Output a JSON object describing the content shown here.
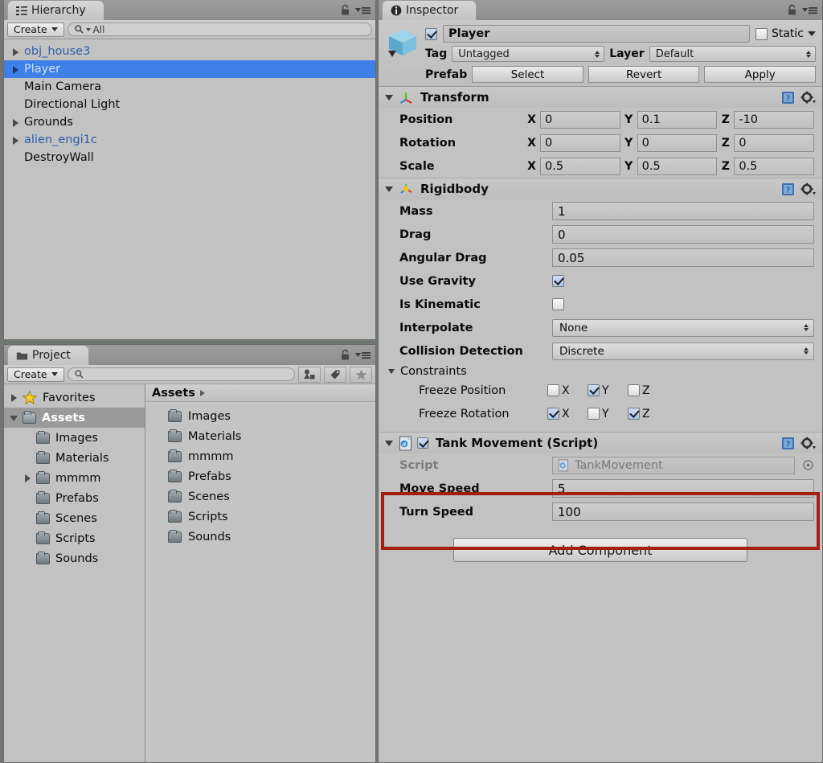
{
  "hierarchy": {
    "tab_title": "Hierarchy",
    "tab_icon": "hierarchy-icon",
    "create_label": "Create",
    "search_value": "All",
    "items": [
      {
        "label": "obj_house3",
        "expandable": true,
        "selected": false,
        "prefab": true,
        "depth": 0
      },
      {
        "label": "Player",
        "expandable": true,
        "selected": true,
        "prefab": true,
        "depth": 0
      },
      {
        "label": "Main Camera",
        "expandable": false,
        "selected": false,
        "prefab": false,
        "depth": 0
      },
      {
        "label": "Directional Light",
        "expandable": false,
        "selected": false,
        "prefab": false,
        "depth": 0
      },
      {
        "label": "Grounds",
        "expandable": true,
        "selected": false,
        "prefab": false,
        "depth": 0
      },
      {
        "label": "alien_engi1c",
        "expandable": true,
        "selected": false,
        "prefab": true,
        "depth": 0
      },
      {
        "label": "DestroyWall",
        "expandable": false,
        "selected": false,
        "prefab": false,
        "depth": 0
      }
    ]
  },
  "project": {
    "tab_title": "Project",
    "create_label": "Create",
    "search_value": "",
    "breadcrumb": "Assets",
    "favorites_label": "Favorites",
    "tree": [
      {
        "label": "Favorites",
        "type": "favorites",
        "expandable": true,
        "selected": false,
        "depth": 0
      },
      {
        "label": "Assets",
        "type": "folder",
        "expandable": true,
        "expanded": true,
        "selected": true,
        "depth": 0
      },
      {
        "label": "Images",
        "type": "folder",
        "expandable": false,
        "selected": false,
        "depth": 1
      },
      {
        "label": "Materials",
        "type": "folder",
        "expandable": false,
        "selected": false,
        "depth": 1
      },
      {
        "label": "mmmm",
        "type": "folder",
        "expandable": true,
        "selected": false,
        "depth": 1
      },
      {
        "label": "Prefabs",
        "type": "folder",
        "expandable": false,
        "selected": false,
        "depth": 1
      },
      {
        "label": "Scenes",
        "type": "folder",
        "expandable": false,
        "selected": false,
        "depth": 1
      },
      {
        "label": "Scripts",
        "type": "folder",
        "expandable": false,
        "selected": false,
        "depth": 1
      },
      {
        "label": "Sounds",
        "type": "folder",
        "expandable": false,
        "selected": false,
        "depth": 1
      }
    ],
    "contents": [
      "Images",
      "Materials",
      "mmmm",
      "Prefabs",
      "Scenes",
      "Scripts",
      "Sounds"
    ]
  },
  "inspector": {
    "tab_title": "Inspector",
    "object_name": "Player",
    "object_enabled": true,
    "static_label": "Static",
    "static_checked": false,
    "tag_label": "Tag",
    "tag_value": "Untagged",
    "layer_label": "Layer",
    "layer_value": "Default",
    "prefab_label": "Prefab",
    "prefab_buttons": [
      "Select",
      "Revert",
      "Apply"
    ],
    "add_component_label": "Add Component",
    "components": [
      {
        "name": "Transform",
        "icon": "transform-axis-icon",
        "rows": [
          {
            "label": "Position",
            "x": "0",
            "y": "0.1",
            "z": "-10"
          },
          {
            "label": "Rotation",
            "x": "0",
            "y": "0",
            "z": "0"
          },
          {
            "label": "Scale",
            "x": "0.5",
            "y": "0.5",
            "z": "0.5"
          }
        ]
      },
      {
        "name": "Rigidbody",
        "icon": "rigidbody-icon",
        "fields": [
          {
            "label": "Mass",
            "value": "1",
            "kind": "number"
          },
          {
            "label": "Drag",
            "value": "0",
            "kind": "number"
          },
          {
            "label": "Angular Drag",
            "value": "0.05",
            "kind": "number"
          },
          {
            "label": "Use Gravity",
            "value": true,
            "kind": "checkbox"
          },
          {
            "label": "Is Kinematic",
            "value": false,
            "kind": "checkbox"
          },
          {
            "label": "Interpolate",
            "value": "None",
            "kind": "popup"
          },
          {
            "label": "Collision Detection",
            "value": "Discrete",
            "kind": "popup"
          }
        ],
        "constraints": {
          "label": "Constraints",
          "freeze_position": {
            "label": "Freeze Position",
            "x": false,
            "y": true,
            "z": false
          },
          "freeze_rotation": {
            "label": "Freeze Rotation",
            "x": true,
            "y": false,
            "z": true
          }
        }
      },
      {
        "name": "Tank Movement (Script)",
        "icon": "csharp-script-icon",
        "enabled": true,
        "script_label": "Script",
        "script_value": "TankMovement",
        "fields": [
          {
            "label": "Move Speed",
            "value": "5",
            "kind": "number"
          },
          {
            "label": "Turn Speed",
            "value": "100",
            "kind": "number"
          }
        ]
      }
    ]
  },
  "highlight": {
    "color": "#a41f11"
  },
  "theme": {
    "background": "#c2c2c2",
    "selection": "#3f7fe8",
    "prefab_text": "#2d5fa8"
  }
}
